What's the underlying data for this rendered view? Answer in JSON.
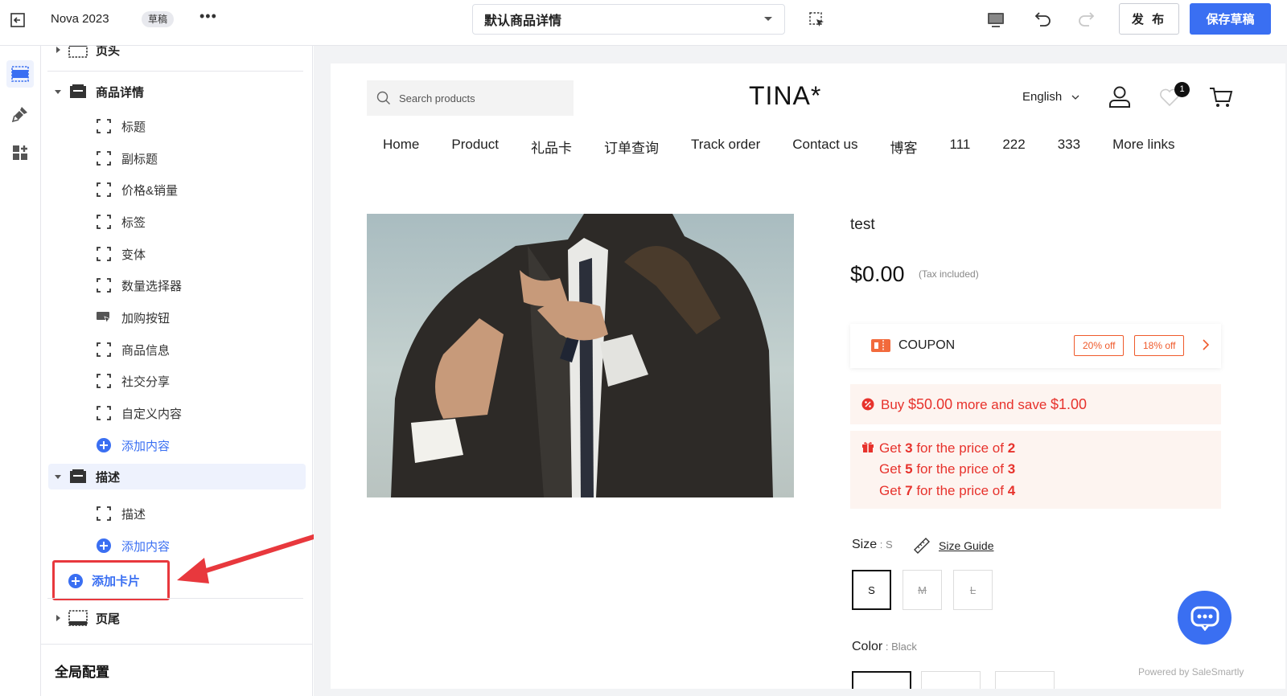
{
  "topbar": {
    "theme_name": "Nova 2023",
    "draft_badge": "草稿",
    "more": "•••",
    "page_select": "默认商品详情",
    "publish": "发 布",
    "save_draft": "保存草稿"
  },
  "tree": {
    "header_partial": "页头",
    "product_section": "商品详情",
    "product_children": [
      "标题",
      "副标题",
      "价格&销量",
      "标签",
      "变体",
      "数量选择器",
      "加购按钮",
      "商品信息",
      "社交分享",
      "自定义内容"
    ],
    "add_content": "添加内容",
    "desc_section": "描述",
    "desc_children": [
      "描述"
    ],
    "add_content_2": "添加内容",
    "add_card": "添加卡片",
    "footer": "页尾",
    "global_config": "全局配置"
  },
  "store": {
    "search_placeholder": "Search products",
    "logo": "TINA*",
    "language": "English",
    "wishlist_count": "1",
    "nav": [
      "Home",
      "Product",
      "礼品卡",
      "订单查询",
      "Track order",
      "Contact us",
      "博客",
      "111",
      "222",
      "333",
      "More links"
    ]
  },
  "product": {
    "title": "test",
    "price": "$0.00",
    "tax_note": "(Tax included)",
    "coupon_label": "COUPON",
    "coupon_tags": [
      "20% off",
      "18% off"
    ],
    "promo_buy": {
      "pre": "Buy ",
      "amount": "$50.00",
      "mid": " more and save ",
      "save": "$1.00"
    },
    "promo_lines": [
      {
        "a": "Get ",
        "b": "3",
        "c": " for the price of ",
        "d": "2"
      },
      {
        "a": "Get ",
        "b": "5",
        "c": " for the price of ",
        "d": "3"
      },
      {
        "a": "Get ",
        "b": "7",
        "c": " for the price of ",
        "d": "4"
      }
    ],
    "size_label": "Size",
    "size_value": " : S",
    "size_guide": "Size Guide",
    "sizes": [
      "S",
      "M",
      "L"
    ],
    "color_label": "Color",
    "color_value": " : Black"
  },
  "chat": {
    "powered_by": "Powered by SaleSmartly"
  },
  "colors": {
    "accent": "#3a6ff2",
    "promo_red": "#e7322c",
    "annotation_red": "#e8383d"
  }
}
